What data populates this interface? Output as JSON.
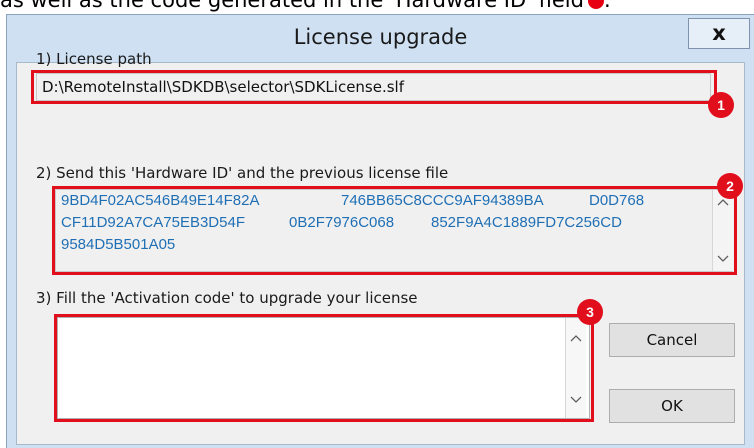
{
  "caption": {
    "text": "as well as the code generated in the 'Hardware ID' field",
    "trailing": "."
  },
  "dialog": {
    "title": "License upgrade",
    "close_label": "x"
  },
  "license_path": {
    "label": "1) License path",
    "value": "D:\\RemoteInstall\\SDKDB\\selector\\SDKLicense.slf"
  },
  "hardware_id": {
    "label": "2) Send this 'Hardware ID' and the previous license file",
    "lines": [
      [
        "9BD4F02AC546B49E14F82A",
        "746BB65C8CCC9AF94389BA",
        "D0D768"
      ],
      [
        "CF11D92A7CA75EB3D54F",
        "0B2F7976C068",
        "852F9A4C1889FD7C256CD"
      ],
      [
        "9584D5B501A05"
      ]
    ]
  },
  "activation": {
    "label": "3) Fill the 'Activation code' to upgrade your license",
    "value": ""
  },
  "buttons": {
    "cancel": "Cancel",
    "ok": "OK"
  },
  "annotations": [
    "1",
    "2",
    "3"
  ],
  "colors": {
    "highlight": "#e10e1c",
    "hardware_id_text": "#1f6fb5",
    "window_frame": "#cfe0f3"
  }
}
